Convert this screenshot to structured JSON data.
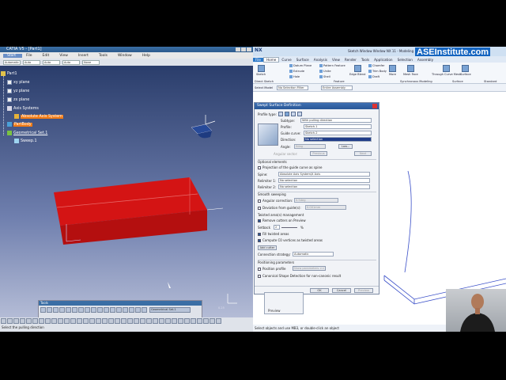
{
  "catia": {
    "title": "CATIA V5 - [Part1]",
    "menu": [
      "Start",
      "File",
      "Edit",
      "View",
      "Insert",
      "Tools",
      "Window",
      "Help"
    ],
    "toolbar_combos": [
      "Automatic",
      "Auto",
      "Auto",
      "Auto",
      "None"
    ],
    "tree": [
      {
        "label": "Part1",
        "icon": "part-icon"
      },
      {
        "label": "xy plane",
        "icon": "plane-icon"
      },
      {
        "label": "yz plane",
        "icon": "plane-icon"
      },
      {
        "label": "zx plane",
        "icon": "plane-icon"
      },
      {
        "label": "Axis Systems",
        "icon": "axis-systems-icon"
      },
      {
        "label": "Absolute Axis System",
        "icon": "axis-icon",
        "highlight": true
      },
      {
        "label": "PartBody",
        "icon": "body-icon",
        "highlight": true
      },
      {
        "label": "Geometrical Set.1",
        "icon": "geoset-icon"
      },
      {
        "label": "Sweep.1",
        "icon": "sweep-icon"
      }
    ],
    "floating_toolbar": {
      "title": "Tools",
      "combo": "Geometrical Set.1"
    },
    "status_text": "Select the pulling direction",
    "viewport_scale": "0.25"
  },
  "nx": {
    "title": "Sketch Window   Window  NX 11 - Modeling",
    "banner": "ASEInstitute.com",
    "tabs": [
      "File",
      "Home",
      "Curve",
      "Surface",
      "Analysis",
      "View",
      "Render",
      "Tools",
      "Application",
      "Selection",
      "Assembly"
    ],
    "active_tab": "Home",
    "ribbon": {
      "sketch": "Sketch",
      "datum_plane": "Datum Plane",
      "extrude": "Extrude",
      "hole": "Hole",
      "pattern_feature": "Pattern Feature",
      "unite": "Unite",
      "shell": "Shell",
      "edge_blend": "Edge Blend",
      "chamfer": "Chamfer",
      "trim_body": "Trim Body",
      "draft": "Draft",
      "more": "More",
      "mesh_face": "Mesh Face",
      "through_curve_mesh": "Through Curve Mesh",
      "surface": "Surface",
      "synchronous": "Synchronous Modeling",
      "direct_sketch": "Direct Sketch",
      "feature": "Feature",
      "surface_group": "Surface",
      "standard": "Standard"
    },
    "filter": {
      "label": "Select Model",
      "selection_filter": "No Selection Filter",
      "assembly": "Entire Assembly"
    },
    "status_text": "Select objects and use MB3, or double-click an object"
  },
  "dialog": {
    "title": "Swept Surface Definition",
    "profile_type_label": "Profile type:",
    "subtype_label": "Subtype:",
    "subtype_value": "With pulling direction",
    "profile_label": "Profile:",
    "profile_value": "Sketch.1",
    "guide_label": "Guide curve:",
    "guide_value": "Sketch.2",
    "direction_label": "Direction:",
    "direction_value": "No selection",
    "angle_label": "Angle:",
    "angle_value": "0deg",
    "law_button": "Law...",
    "angular_sector_label": "Angular sector:",
    "previous_button": "Previous",
    "next_button": "Next",
    "optional_elements": "Optional elements",
    "projection_check": "Projection of the guide curve as spine",
    "spine_label": "Spine:",
    "spine_value": "Absolute Axis System\\X Axis",
    "relimiter1_label": "Relimiter 1:",
    "relimiter1_value": "No selection",
    "relimiter2_label": "Relimiter 2:",
    "relimiter2_value": "No selection",
    "smooth_sweeping": "Smooth sweeping",
    "angular_correction": "Angular correction:",
    "angular_correction_value": "0.5deg",
    "deviation_label": "Deviation from guide(s):",
    "deviation_value": "0.001mm",
    "twisted_areas": "Twisted area(s) management",
    "remove_cutters": "Remove cutters on Preview",
    "setback_label": "Setback",
    "setback_value": "2",
    "setback_unit": "%",
    "fill_twisted": "Fill twisted areas",
    "compute_c0": "Compute C0 vertices as twisted areas",
    "add_cutter": "Add cutter",
    "connection_label": "Connection strategy:",
    "connection_value": "Automatic",
    "positioning": "Positioning parameters",
    "position_profile": "Position profile",
    "show_parameters": "Show parameters >>",
    "canonical": "Canonical Shape Detection for non-canonic result",
    "ok": "OK",
    "cancel": "Cancel",
    "preview": "Preview"
  },
  "sub_panel": {
    "label": "Preview"
  }
}
